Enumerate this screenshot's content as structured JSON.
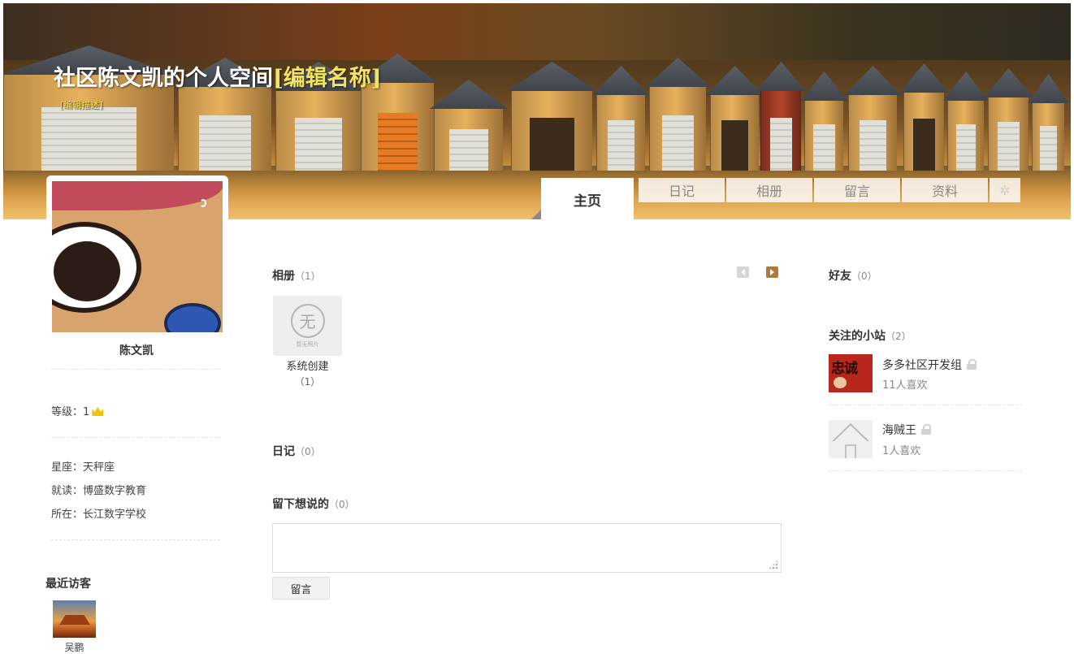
{
  "banner": {
    "title": "社区陈文凯的个人空间",
    "edit_name": "[编辑名称]",
    "edit_desc": "[编辑描述]"
  },
  "tabs": [
    {
      "label": "主页",
      "active": true
    },
    {
      "label": "日记",
      "active": false
    },
    {
      "label": "相册",
      "active": false
    },
    {
      "label": "留言",
      "active": false
    },
    {
      "label": "资料",
      "active": false
    }
  ],
  "tab_settings_icon": "gear-icon",
  "profile": {
    "name": "陈文凯",
    "level_label": "等级：",
    "level_value": "1",
    "level_icon": "crown-icon",
    "constellation": "星座：天秤座",
    "school": "就读：博盛数字教育",
    "location": "所在：长江数字学校"
  },
  "recent_visitors": {
    "title": "最近访客",
    "items": [
      {
        "name": "吴鹏"
      }
    ]
  },
  "albums": {
    "title": "相册",
    "count": "（1）",
    "items": [
      {
        "cover_glyph": "无",
        "cover_caption": "暂无照片",
        "name": "系统创建",
        "count": "（1）"
      }
    ]
  },
  "diary": {
    "title": "日记",
    "count": "（0）"
  },
  "messages": {
    "title": "留下想说的",
    "count": "（0）",
    "textarea_value": "",
    "submit_label": "留言"
  },
  "friends": {
    "title": "好友",
    "count": "（0）"
  },
  "followed_sites": {
    "title": "关注的小站",
    "count": "（2）",
    "items": [
      {
        "name": "多多社区开发组",
        "likes": "11人喜欢",
        "thumb_glyph": "忠诚"
      },
      {
        "name": "海贼王",
        "likes": "1人喜欢"
      }
    ]
  },
  "colors": {
    "accent": "#f4e45a",
    "pager_active": "#b07a3a",
    "pager_inactive": "#d6d6d6"
  }
}
